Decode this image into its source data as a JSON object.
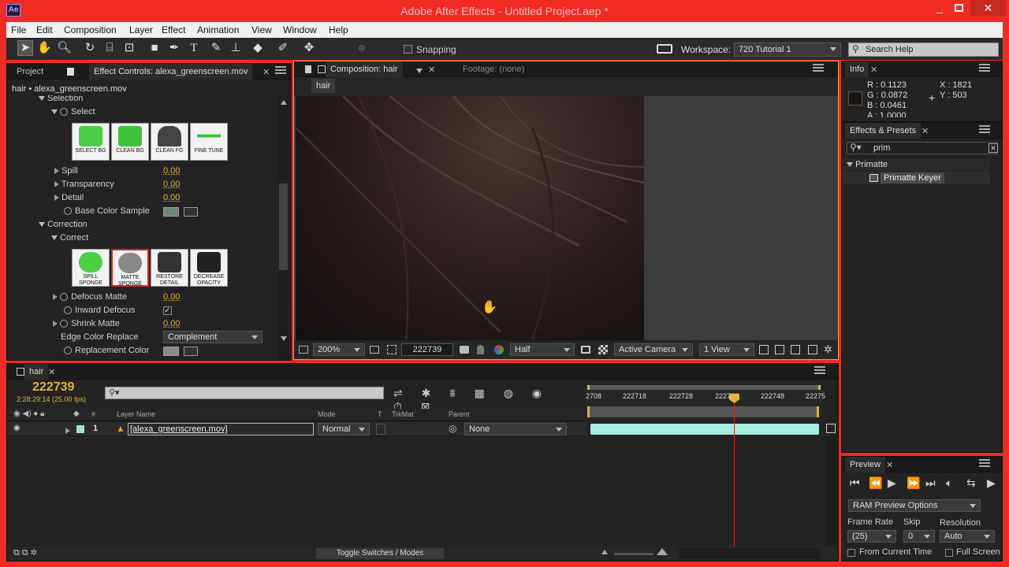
{
  "window": {
    "app_icon": "Ae",
    "title": "Adobe After Effects - Untitled Project.aep *",
    "controls": [
      "minimize-icon",
      "maximize-icon",
      "close-icon"
    ]
  },
  "menu": [
    "File",
    "Edit",
    "Composition",
    "Layer",
    "Effect",
    "Animation",
    "View",
    "Window",
    "Help"
  ],
  "toolbar": {
    "snapping_label": "Snapping",
    "workspace_label": "Workspace:",
    "workspace_value": "720 Tutorial 1",
    "search_placeholder": "Search Help"
  },
  "project_panel": {
    "tab_project": "Project",
    "tab_effect_controls": "Effect Controls: alexa_greenscreen.mov",
    "layer_path": "hair • alexa_greenscreen.mov",
    "selection_header": "Selection",
    "select_label": "Select",
    "select_buttons": [
      "SELECT BG",
      "CLEAN BG",
      "CLEAN FG",
      "FINE TUNE"
    ],
    "spill": {
      "label": "Spill",
      "value": "0.00"
    },
    "transparency": {
      "label": "Transparency",
      "value": "0.00"
    },
    "detail": {
      "label": "Detail",
      "value": "0.00"
    },
    "base_color": {
      "label": "Base Color Sample",
      "swatch": "#6f8a74"
    },
    "correction_header": "Correction",
    "correct_label": "Correct",
    "correct_buttons": [
      "SPILL SPONGE",
      "MATTE SPONGE",
      "RESTORE DETAIL",
      "DECREASE OPACITY"
    ],
    "defocus": {
      "label": "Defocus Matte",
      "value": "0.00"
    },
    "inward_defocus": {
      "label": "Inward Defocus",
      "checked": true
    },
    "shrink": {
      "label": "Shrink Matte",
      "value": "0.00"
    },
    "edge_color_replace": {
      "label": "Edge Color Replace",
      "value": "Complement"
    },
    "replacement_color": {
      "label": "Replacement Color",
      "swatch": "#8a8a8a"
    }
  },
  "composition_panel": {
    "tab_comp": "Composition: hair",
    "tab_footage": "Footage: (none)",
    "breadcrumb": "hair",
    "zoom": "200%",
    "timecode": "222739",
    "resolution": "Half",
    "camera": "Active Camera",
    "views": "1 View"
  },
  "info_panel": {
    "tab": "Info",
    "r": "R : 0.1123",
    "g": "G : 0.0872",
    "b": "B : 0.0461",
    "a": "A : 1.0000",
    "x": "X : 1821",
    "y": "Y : 503"
  },
  "effects_presets": {
    "tab": "Effects & Presets",
    "search_value": "prim",
    "category": "Primatte",
    "item": "Primatte Keyer"
  },
  "timeline": {
    "tab": "hair",
    "current_time": "222739",
    "time_detail": "2:28:29:14 (25.00 fps)",
    "columns": {
      "num": "#",
      "layer_name": "Layer Name",
      "mode": "Mode",
      "t": "T",
      "trkmat": "TrkMat",
      "parent": "Parent"
    },
    "layer": {
      "index": "1",
      "name": "[alexa_greenscreen.mov]",
      "mode": "Normal",
      "parent": "None"
    },
    "ruler": [
      "2708",
      "222718",
      "222728",
      "222738",
      "222748",
      "22275"
    ],
    "playhead_fraction": 0.61,
    "toggle_label": "Toggle Switches / Modes"
  },
  "preview_panel": {
    "tab": "Preview",
    "ram_options": "RAM Preview Options",
    "frame_rate_label": "Frame Rate",
    "skip_label": "Skip",
    "resolution_label": "Resolution",
    "frame_rate_value": "(25)",
    "skip_value": "0",
    "resolution_value": "Auto",
    "from_current_time": "From Current Time",
    "full_screen": "Full Screen"
  }
}
